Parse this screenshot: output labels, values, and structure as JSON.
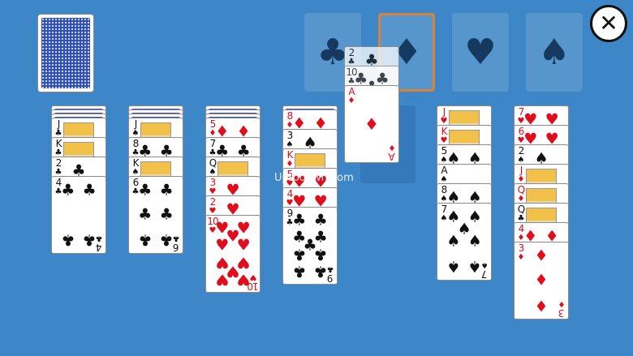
{
  "game": {
    "watermark": "Uptodown.com",
    "close_icon_glyph": "✕",
    "stock_count_visible": 1,
    "foundations": [
      {
        "name": "clubs",
        "glyph": "♣",
        "selected": false
      },
      {
        "name": "diamonds",
        "glyph": "♦",
        "selected": true
      },
      {
        "name": "hearts",
        "glyph": "♥",
        "selected": false
      },
      {
        "name": "spades",
        "glyph": "♠",
        "selected": false
      }
    ],
    "dragging": [
      {
        "rank": "2",
        "suit": "♣"
      },
      {
        "rank": "10",
        "suit": "♣"
      },
      {
        "rank": "A",
        "suit": "♦"
      }
    ],
    "tableau": [
      {
        "hidden": 3,
        "cards": [
          {
            "rank": "J",
            "suit": "♣"
          },
          {
            "rank": "K",
            "suit": "♣"
          },
          {
            "rank": "2",
            "suit": "♣"
          },
          {
            "rank": "4",
            "suit": "♣"
          }
        ]
      },
      {
        "hidden": 3,
        "cards": [
          {
            "rank": "J",
            "suit": "♠"
          },
          {
            "rank": "8",
            "suit": "♣"
          },
          {
            "rank": "K",
            "suit": "♠"
          },
          {
            "rank": "6",
            "suit": "♣"
          }
        ]
      },
      {
        "hidden": 3,
        "cards": [
          {
            "rank": "5",
            "suit": "♦"
          },
          {
            "rank": "7",
            "suit": "♣"
          },
          {
            "rank": "Q",
            "suit": "♠"
          },
          {
            "rank": "3",
            "suit": "♥"
          },
          {
            "rank": "2",
            "suit": "♥"
          },
          {
            "rank": "10",
            "suit": "♥"
          }
        ]
      },
      {
        "hidden": 1,
        "cards": [
          {
            "rank": "8",
            "suit": "♦"
          },
          {
            "rank": "3",
            "suit": "♠"
          },
          {
            "rank": "K",
            "suit": "♦"
          },
          {
            "rank": "5",
            "suit": "♥"
          },
          {
            "rank": "4",
            "suit": "♥"
          },
          {
            "rank": "9",
            "suit": "♣"
          }
        ]
      },
      {
        "hidden": 0,
        "cards": []
      },
      {
        "hidden": 0,
        "cards": [
          {
            "rank": "J",
            "suit": "♥"
          },
          {
            "rank": "K",
            "suit": "♥"
          },
          {
            "rank": "5",
            "suit": "♠"
          },
          {
            "rank": "A",
            "suit": "♠"
          },
          {
            "rank": "8",
            "suit": "♠"
          },
          {
            "rank": "7",
            "suit": "♠"
          }
        ]
      },
      {
        "hidden": 0,
        "cards": [
          {
            "rank": "7",
            "suit": "♥"
          },
          {
            "rank": "6",
            "suit": "♥"
          },
          {
            "rank": "2",
            "suit": "♠"
          },
          {
            "rank": "J",
            "suit": "♦"
          },
          {
            "rank": "Q",
            "suit": "♦"
          },
          {
            "rank": "Q",
            "suit": "♣"
          },
          {
            "rank": "4",
            "suit": "♦"
          },
          {
            "rank": "3",
            "suit": "♦"
          }
        ]
      }
    ]
  }
}
